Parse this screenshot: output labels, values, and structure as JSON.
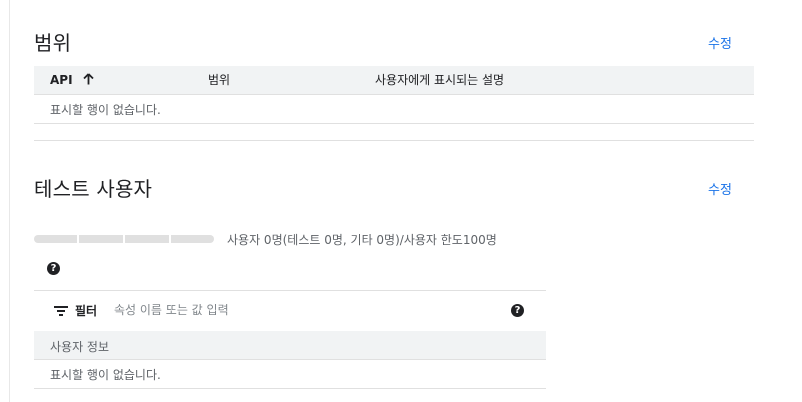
{
  "scopes": {
    "title": "범위",
    "edit_label": "수정",
    "columns": [
      "API",
      "범위",
      "사용자에게 표시되는 설명"
    ],
    "sort_icon": "arrow-up-icon",
    "empty_text": "표시할 행이 없습니다."
  },
  "test_users": {
    "title": "테스트 사용자",
    "edit_label": "수정",
    "quota_fraction": 0,
    "quota_text": "사용자 0명(테스트 0명, 기타 0명)/사용자 한도100명",
    "help_icon": "help-icon",
    "filter": {
      "icon": "filter-icon",
      "label": "필터",
      "placeholder": "속성 이름 또는 값 입력",
      "value": ""
    },
    "table": {
      "columns": [
        "사용자 정보"
      ],
      "empty_text": "표시할 행이 없습니다."
    }
  },
  "colors": {
    "link": "#1a73e8",
    "header_bg": "#f1f3f4",
    "border": "#e0e0e0",
    "muted_text": "#5f6368"
  }
}
